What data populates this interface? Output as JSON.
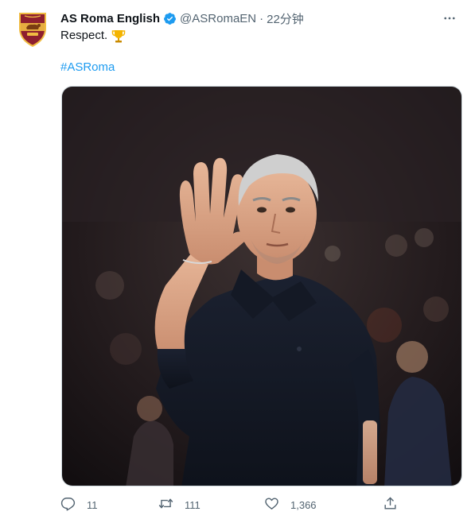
{
  "tweet": {
    "author_name": "AS Roma English",
    "handle": "@ASRomaEN",
    "separator": "·",
    "time": "22分钟",
    "text": "Respect.",
    "hashtag": "#ASRoma",
    "media_alt": "Photo of a man in a black polo shirt raising an open hand toward the stadium crowd",
    "verified_icon": "verified-badge-icon",
    "emoji": "trophy-icon"
  },
  "actions": {
    "reply_count": "11",
    "retweet_count": "111",
    "like_count": "1,366"
  },
  "colors": {
    "link": "#1d9bf0",
    "secondary_text": "#536471",
    "primary_text": "#0f1419",
    "crest_red": "#8e1f2f",
    "crest_gold": "#f0bc42"
  }
}
